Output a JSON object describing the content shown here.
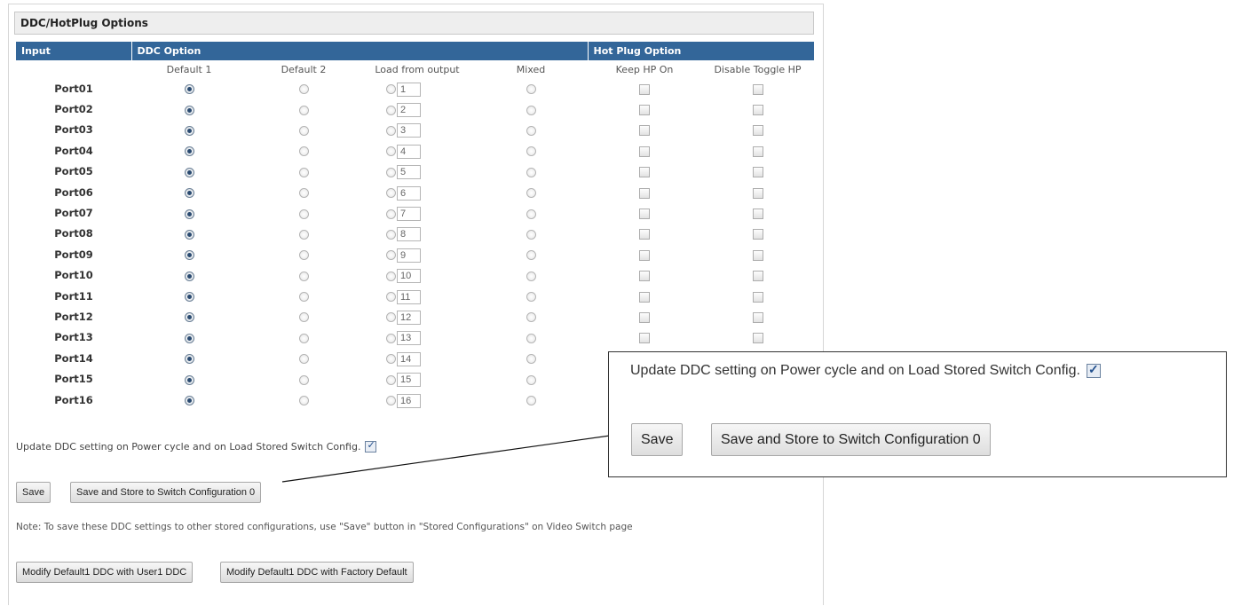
{
  "panel": {
    "title": "DDC/HotPlug Options"
  },
  "table": {
    "headers": {
      "input": "Input",
      "ddc": "DDC Option",
      "hotplug": "Hot Plug Option"
    },
    "subheaders": [
      "Default 1",
      "Default 2",
      "Load from output",
      "Mixed",
      "Keep HP On",
      "Disable Toggle HP"
    ],
    "rows": [
      {
        "port": "Port01",
        "output": "1"
      },
      {
        "port": "Port02",
        "output": "2"
      },
      {
        "port": "Port03",
        "output": "3"
      },
      {
        "port": "Port04",
        "output": "4"
      },
      {
        "port": "Port05",
        "output": "5"
      },
      {
        "port": "Port06",
        "output": "6"
      },
      {
        "port": "Port07",
        "output": "7"
      },
      {
        "port": "Port08",
        "output": "8"
      },
      {
        "port": "Port09",
        "output": "9"
      },
      {
        "port": "Port10",
        "output": "10"
      },
      {
        "port": "Port11",
        "output": "11"
      },
      {
        "port": "Port12",
        "output": "12"
      },
      {
        "port": "Port13",
        "output": "13"
      },
      {
        "port": "Port14",
        "output": "14"
      },
      {
        "port": "Port15",
        "output": "15"
      },
      {
        "port": "Port16",
        "output": "16"
      }
    ],
    "selected_option": "Default 1"
  },
  "update_setting": {
    "label": "Update DDC setting on Power cycle and on Load Stored Switch Config.",
    "checked": true
  },
  "buttons": {
    "save": "Save",
    "save_store": "Save and Store to Switch Configuration 0",
    "modify_user1": "Modify Default1 DDC with User1 DDC",
    "modify_factory": "Modify Default1 DDC with Factory Default"
  },
  "note": "Note: To save these DDC settings to other stored configurations, use \"Save\" button in \"Stored Configurations\" on Video Switch page",
  "colors": {
    "header_blue": "#336699",
    "panel_header": "#eeeeee"
  }
}
